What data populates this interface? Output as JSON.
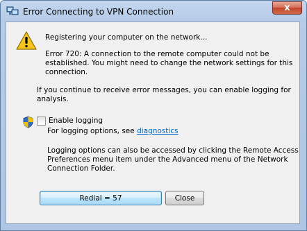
{
  "window": {
    "title": "Error Connecting to VPN Connection",
    "close_glyph": "x"
  },
  "message": {
    "status": "Registering your computer on the network...",
    "error_line1": "Error 720: A connection to the remote computer could not be",
    "error_line2": "established.  You might need to change the network settings for this",
    "error_line3": "connection.",
    "logging_hint_line1": "If you continue to receive error messages, you can enable logging for",
    "logging_hint_line2": "analysis."
  },
  "logging": {
    "checkbox_label": "Enable logging",
    "checked": false,
    "options_prefix": "For logging options, see ",
    "options_link": "diagnostics",
    "note_line1": "Logging options can also be accessed by clicking the Remote Access",
    "note_line2": "Preferences menu item under the Advanced menu of the Network",
    "note_line3": "Connection Folder."
  },
  "buttons": {
    "redial": "Redial = 57",
    "close": "Close"
  },
  "icons": {
    "title": "network-connection-icon",
    "warning": "warning-icon",
    "shield": "uac-shield-icon"
  },
  "colors": {
    "link": "#0066cc",
    "warning_fill": "#f5c518"
  }
}
